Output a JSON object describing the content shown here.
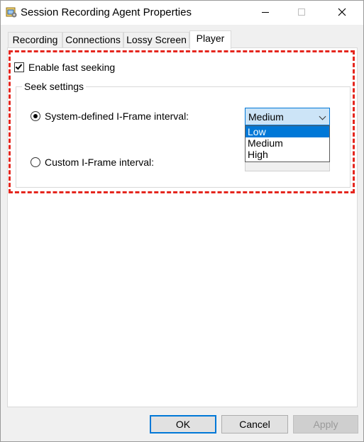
{
  "window": {
    "title": "Session Recording Agent Properties",
    "icon": "app-properties-icon",
    "minimize_glyph": "—",
    "maximize_glyph": "☐",
    "close_glyph": "✕"
  },
  "tabs": [
    {
      "label": "Recording",
      "active": false
    },
    {
      "label": "Connections",
      "active": false
    },
    {
      "label": "Lossy Screen",
      "active": false
    },
    {
      "label": "Player",
      "active": true
    }
  ],
  "player": {
    "fast_seeking": {
      "label": "Enable fast seeking",
      "checked": true
    },
    "seek_settings": {
      "legend": "Seek settings",
      "system_defined": {
        "label": "System-defined I-Frame interval:",
        "selected": true
      },
      "custom": {
        "label": "Custom I-Frame interval:",
        "selected": false
      },
      "interval_select": {
        "value": "Medium",
        "options": [
          "Low",
          "Medium",
          "High"
        ],
        "highlighted_option": "Low"
      }
    }
  },
  "buttons": {
    "ok": "OK",
    "cancel": "Cancel",
    "apply": "Apply"
  },
  "colors": {
    "accent": "#0078d7",
    "highlight_outline": "#e5261e"
  }
}
